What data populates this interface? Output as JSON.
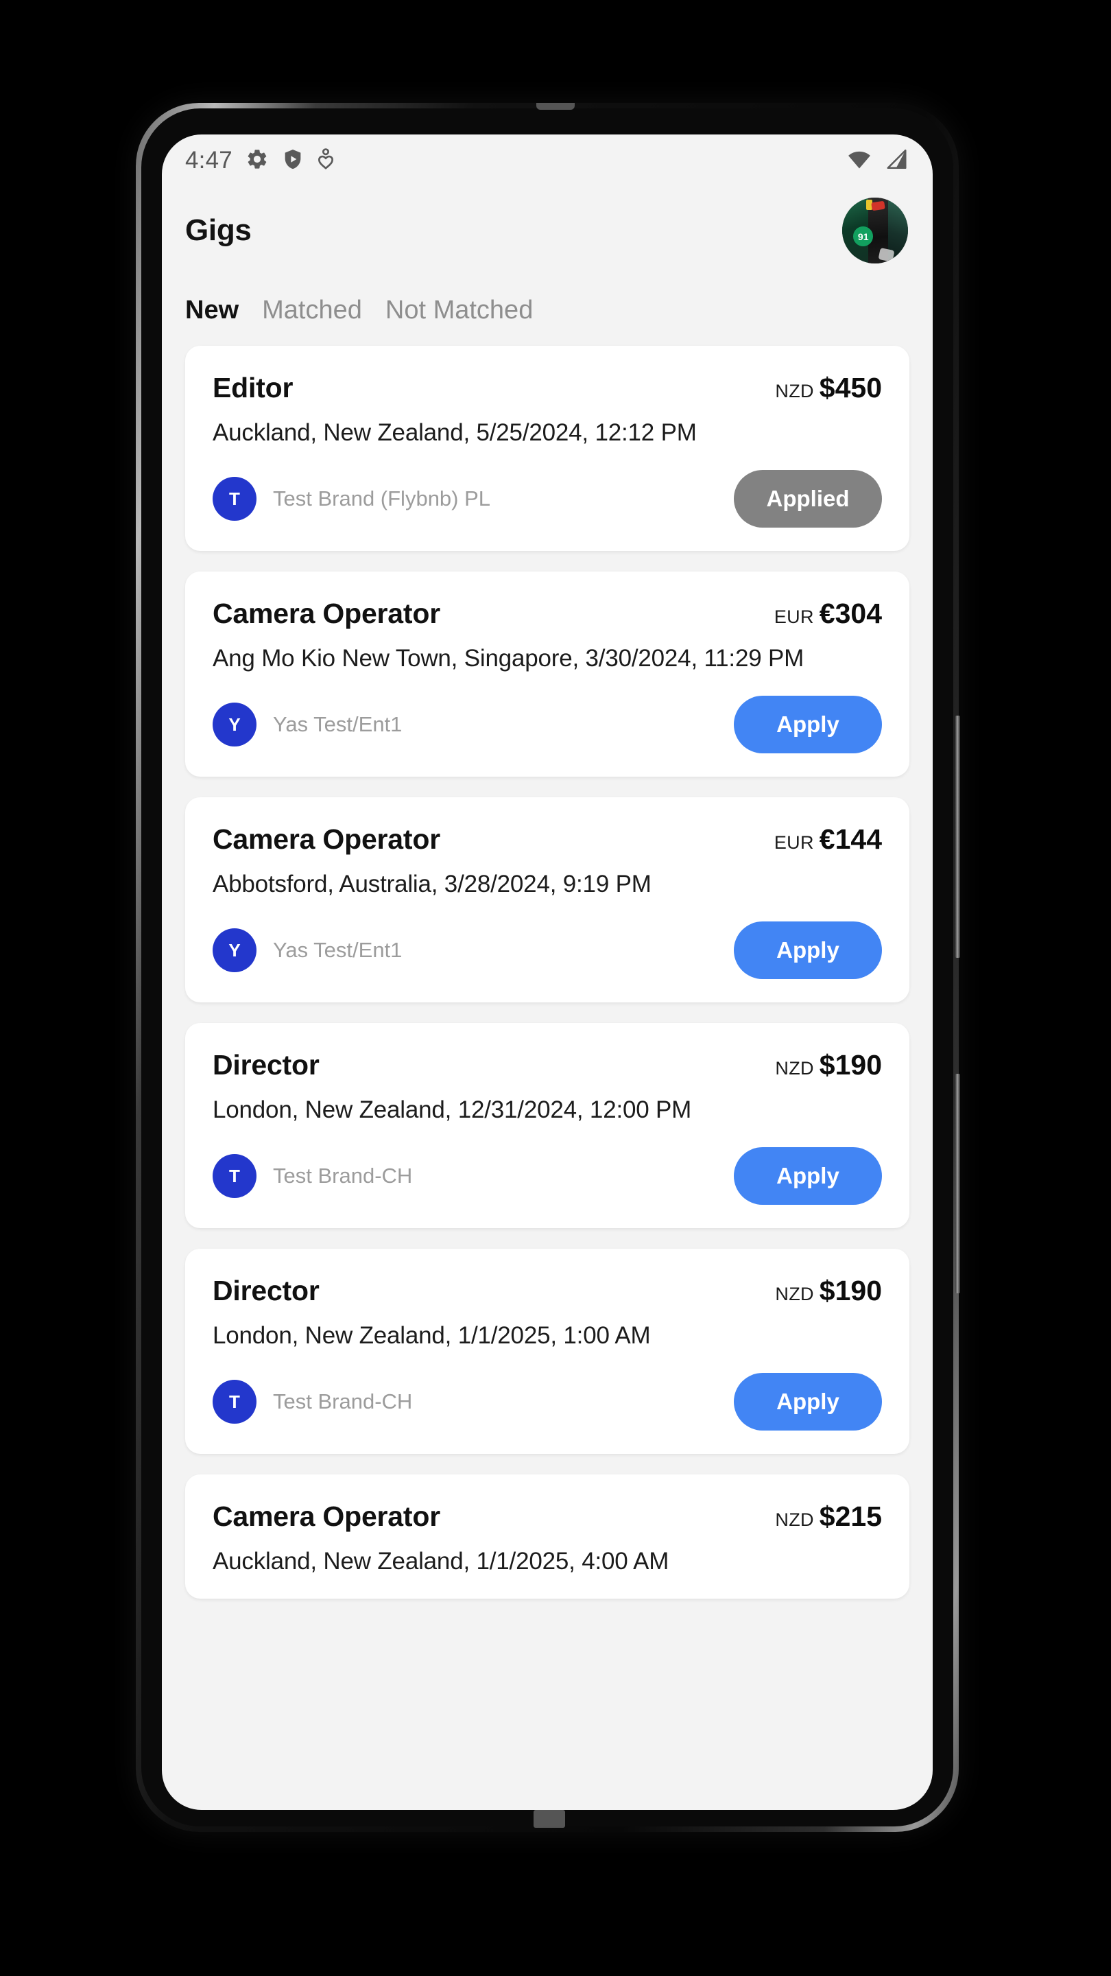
{
  "status_bar": {
    "time": "4:47",
    "left_icons": [
      "gear-icon",
      "play-shield-icon",
      "heart-person-icon"
    ],
    "right_icons": [
      "wifi-icon",
      "cell-signal-icon"
    ]
  },
  "header": {
    "title": "Gigs",
    "avatar": {
      "name": "user-avatar",
      "badge_text": "91"
    }
  },
  "tabs": [
    {
      "label": "New",
      "active": true
    },
    {
      "label": "Matched",
      "active": false
    },
    {
      "label": "Not Matched",
      "active": false
    }
  ],
  "colors": {
    "accent_blue": "#4285f4",
    "avatar_blue": "#2337cc",
    "applied_gray": "#828282",
    "screen_bg": "#f3f3f3",
    "card_bg": "#ffffff",
    "muted_text": "#9c9c9c"
  },
  "gigs": [
    {
      "title": "Editor",
      "currency": "NZD",
      "amount": "$450",
      "meta": "Auckland, New Zealand, 5/25/2024, 12:12 PM",
      "brand_initial": "T",
      "brand_name": "Test Brand (Flybnb) PL",
      "action_label": "Applied",
      "action_state": "applied"
    },
    {
      "title": "Camera Operator",
      "currency": "EUR",
      "amount": "€304",
      "meta": "Ang Mo Kio New Town, Singapore, 3/30/2024, 11:29 PM",
      "brand_initial": "Y",
      "brand_name": "Yas Test/Ent1",
      "action_label": "Apply",
      "action_state": "apply"
    },
    {
      "title": "Camera Operator",
      "currency": "EUR",
      "amount": "€144",
      "meta": "Abbotsford, Australia, 3/28/2024, 9:19 PM",
      "brand_initial": "Y",
      "brand_name": "Yas Test/Ent1",
      "action_label": "Apply",
      "action_state": "apply"
    },
    {
      "title": "Director",
      "currency": "NZD",
      "amount": "$190",
      "meta": "London, New Zealand, 12/31/2024, 12:00 PM",
      "brand_initial": "T",
      "brand_name": "Test Brand-CH",
      "action_label": "Apply",
      "action_state": "apply"
    },
    {
      "title": "Director",
      "currency": "NZD",
      "amount": "$190",
      "meta": "London, New Zealand, 1/1/2025, 1:00 AM",
      "brand_initial": "T",
      "brand_name": "Test Brand-CH",
      "action_label": "Apply",
      "action_state": "apply"
    },
    {
      "title": "Camera Operator",
      "currency": "NZD",
      "amount": "$215",
      "meta": "Auckland, New Zealand, 1/1/2025, 4:00 AM",
      "brand_initial": "",
      "brand_name": "",
      "action_label": "",
      "action_state": "apply"
    }
  ]
}
